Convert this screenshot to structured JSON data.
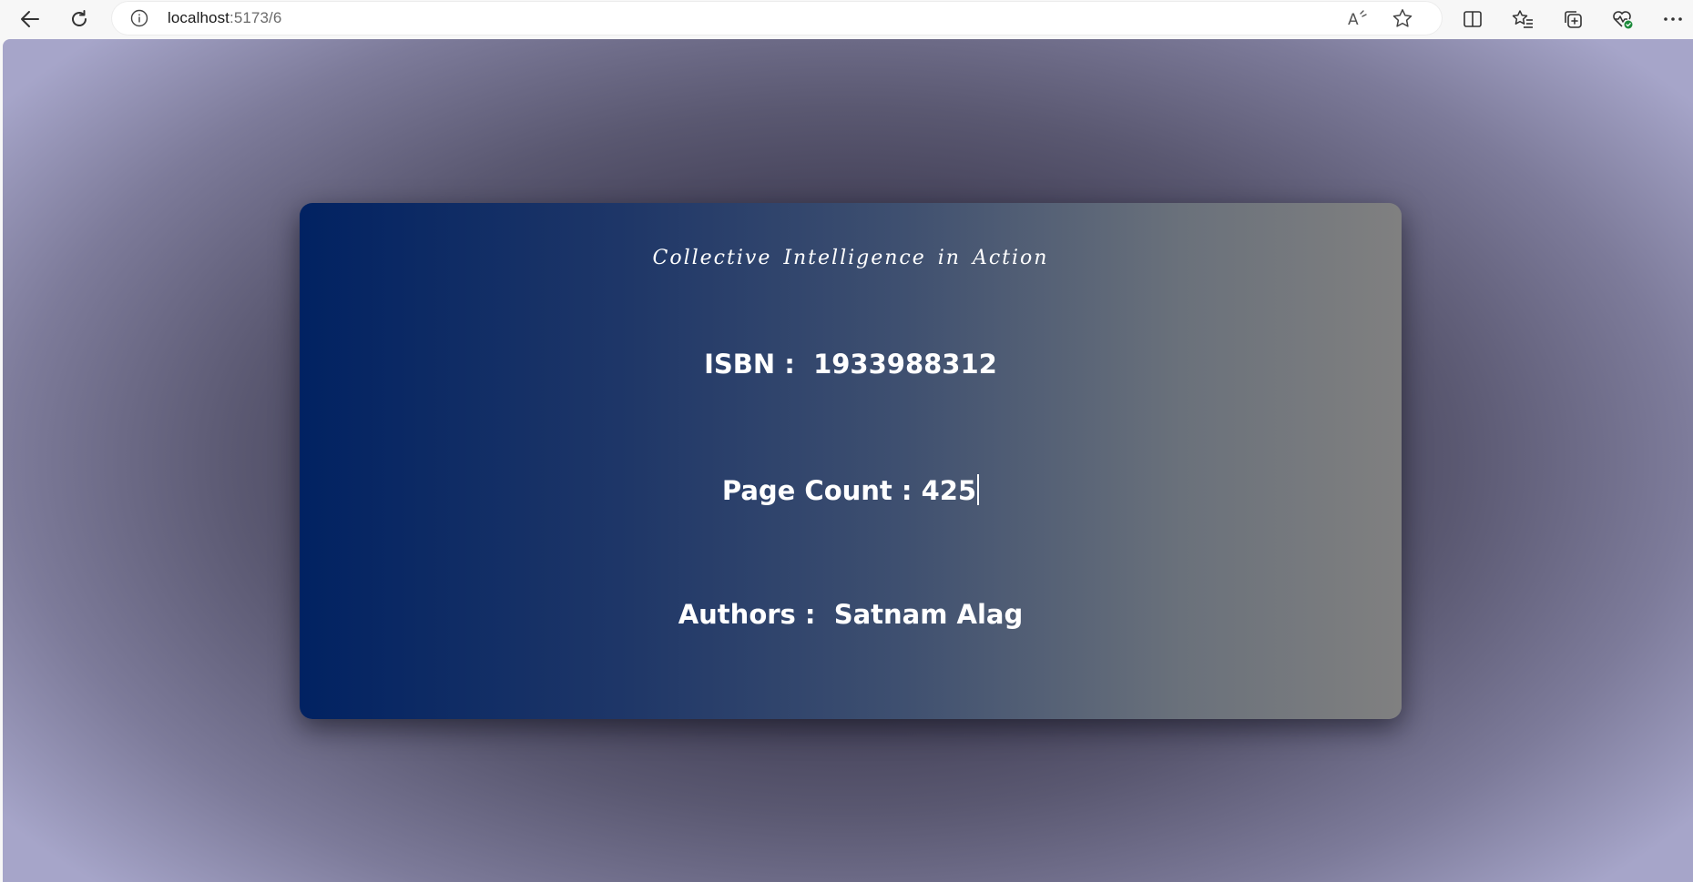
{
  "browser": {
    "url_host": "localhost",
    "url_path": ":5173/6",
    "icons": {
      "back": "back-arrow-icon",
      "refresh": "refresh-icon",
      "info": "info-icon",
      "read_aloud": "read-aloud-icon",
      "favorite": "star-icon",
      "split_screen": "split-screen-icon",
      "favorites": "favorites-icon",
      "collections": "collections-icon",
      "health": "browser-essentials-icon",
      "more": "more-icon"
    }
  },
  "book": {
    "title": "Collective Intelligence in Action",
    "isbn_label": "ISBN :  ",
    "isbn": "1933988312",
    "pages_label": "Page Count : ",
    "pages": "425",
    "authors_label": "Authors :  ",
    "authors": "Satnam Alag"
  },
  "colors": {
    "card_gradient_start": "#012262",
    "card_gradient_end": "#808080",
    "text": "#ffffff"
  }
}
